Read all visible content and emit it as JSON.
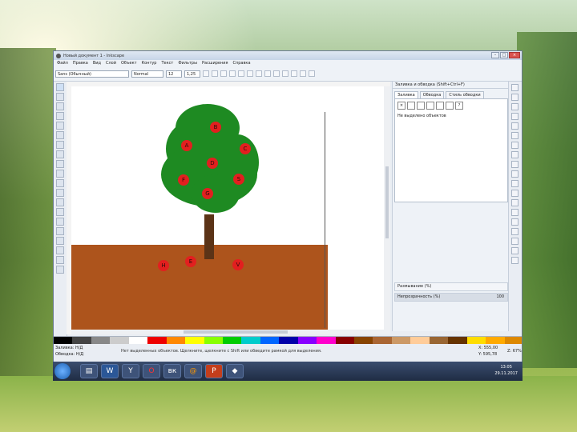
{
  "window": {
    "title": "Новый документ 1 - Inkscape",
    "controls": [
      "–",
      "□",
      "×"
    ]
  },
  "menu": [
    "Файл",
    "Правка",
    "Вид",
    "Слой",
    "Объект",
    "Контур",
    "Текст",
    "Фильтры",
    "Расширения",
    "Справка"
  ],
  "toolbar": {
    "font_family": "Sans (Обычный)",
    "font_style": "Normal",
    "font_size": "12",
    "line_spacing": "1,25"
  },
  "canvas": {
    "apples": [
      {
        "letter": "B"
      },
      {
        "letter": "A"
      },
      {
        "letter": "C"
      },
      {
        "letter": "D"
      },
      {
        "letter": "F"
      },
      {
        "letter": "S"
      },
      {
        "letter": "G"
      },
      {
        "letter": "H"
      },
      {
        "letter": "E"
      },
      {
        "letter": "V"
      }
    ],
    "colors": {
      "crown": "#1e8a22",
      "trunk": "#5b3317",
      "ground": "#ad541c",
      "apple": "#e21f1f"
    }
  },
  "dock": {
    "header": "Заливка и обводка (Shift+Ctrl+F)",
    "tabs": [
      "Заливка",
      "Обводка",
      "Стиль обводки"
    ],
    "note": "Не выделено объектов",
    "blur_label": "Размывание (%)",
    "opacity_label": "Непрозрачность (%)",
    "opacity_value": "100"
  },
  "status": {
    "fill_label": "Заливка:",
    "stroke_label": "Обводка:",
    "fill_value": "Н/Д",
    "stroke_value": "Н/Д",
    "message": "Нет выделенных объектов. Щелкните, щелкните с Shift или обведите рамкой для выделения.",
    "x": "X: 555,00",
    "y": "Y: 595,78",
    "zoom": "Z: 67%"
  },
  "taskbar": {
    "icons": [
      "folder",
      "word",
      "yandex",
      "opera",
      "vk",
      "mail",
      "powerpoint",
      "inkscape"
    ],
    "time": "13:05",
    "date": "29.11.2017"
  }
}
